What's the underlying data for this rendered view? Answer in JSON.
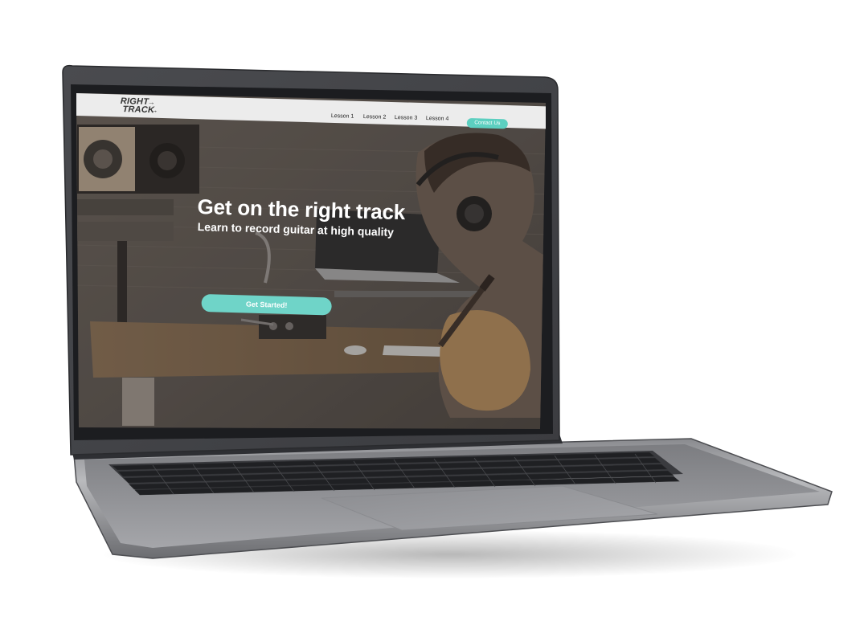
{
  "logo": {
    "line1": "RIGHT",
    "line2": "TRACK"
  },
  "nav": {
    "items": [
      {
        "label": "Lesson 1"
      },
      {
        "label": "Lesson 2"
      },
      {
        "label": "Lesson 3"
      },
      {
        "label": "Lesson 4"
      }
    ],
    "contact_label": "Contact Us"
  },
  "hero": {
    "title": "Get on the right track",
    "subtitle": "Learn to record guitar at high quality",
    "cta_label": "Get Started!"
  },
  "colors": {
    "accent": "#5ccfc0",
    "header_bg": "#ececec",
    "laptop_body": "#5b5c60"
  },
  "icons": {
    "logo_arrow": "arrow-right-icon"
  }
}
